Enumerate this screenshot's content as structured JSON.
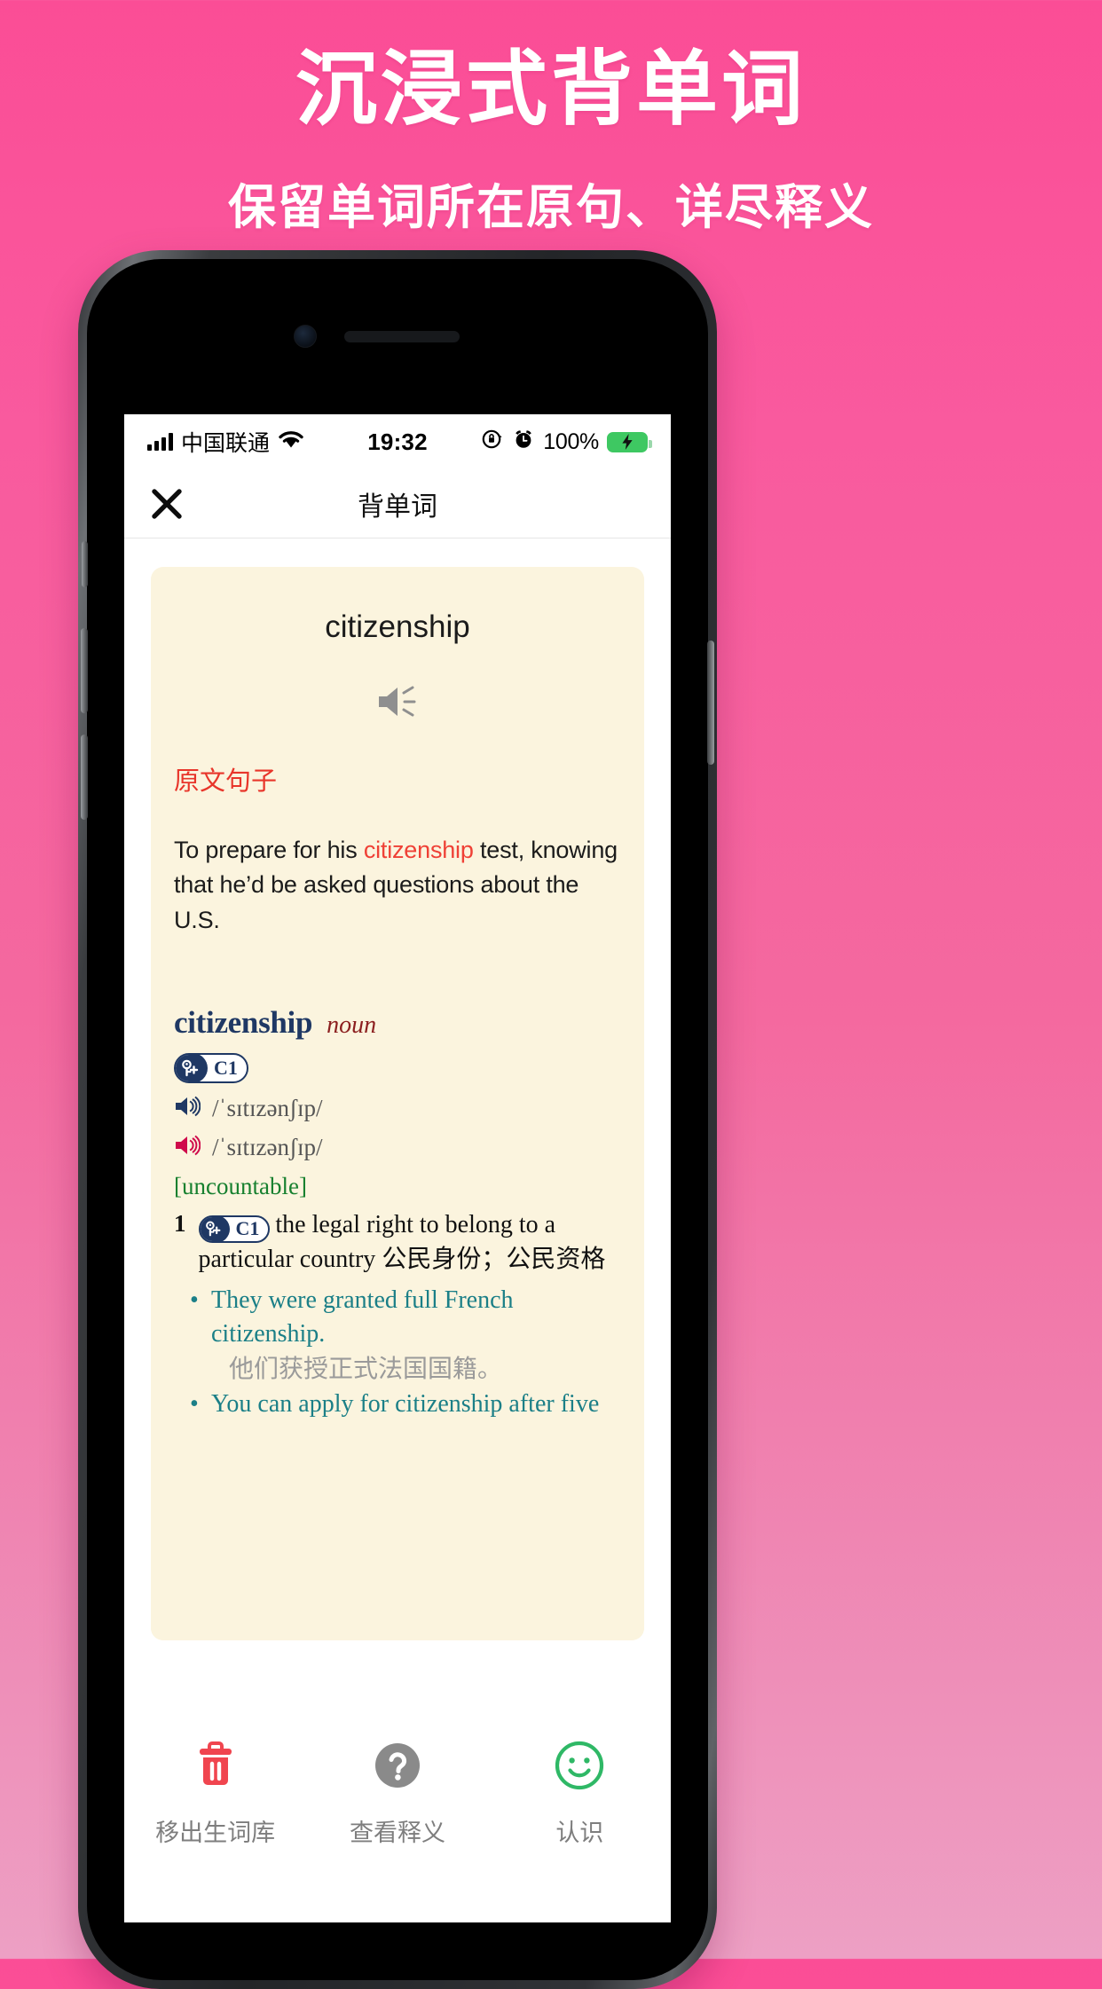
{
  "promo": {
    "title": "沉浸式背单词",
    "subtitle": "保留单词所在原句、详尽释义",
    "bg_start": "#fb4d96",
    "bg_end": "#eda0c4"
  },
  "status_bar": {
    "carrier": "中国联通",
    "signal_icon": "signal-bars-icon",
    "wifi_icon": "wifi-icon",
    "time": "19:32",
    "rotation_lock_icon": "rotation-lock-icon",
    "alarm_icon": "alarm-clock-icon",
    "battery_percent": "100%",
    "battery_icon": "battery-charging-icon",
    "battery_color": "#3ec862"
  },
  "nav": {
    "close_icon": "close-icon",
    "title": "背单词"
  },
  "card": {
    "background": "#fbf4de",
    "word": "citizenship",
    "speaker_icon": "speaker-icon",
    "source_label": "原文句子",
    "source_label_color": "#e8352a",
    "sentence_before": "To prepare for his ",
    "sentence_highlight": "citizenship",
    "sentence_after": " test, knowing that he’d be asked questions about the U.S.",
    "highlight_color": "#ef4136"
  },
  "dictionary": {
    "headword": "citizenship",
    "headword_color": "#1f3864",
    "part_of_speech": "noun",
    "pos_color": "#8c1f1f",
    "cefr_badge": "C1",
    "cefr_icon": "key-plus-icon",
    "pronunciations": [
      {
        "accent_icon": "speaker-icon-british",
        "color": "#1f3864",
        "ipa": "/ˈsɪtɪzənʃɪp/"
      },
      {
        "accent_icon": "speaker-icon-american",
        "color": "#cf0a4b",
        "ipa": "/ˈsɪtɪzənʃɪp/"
      }
    ],
    "grammar_label": "[uncountable]",
    "grammar_color": "#17802f",
    "senses": [
      {
        "number": "1",
        "cefr_badge": "C1",
        "definition_en": "the legal right to belong to a particular country ",
        "definition_cn": "公民身份；公民资格",
        "examples": [
          {
            "en": "They were granted full French citizenship.",
            "cn": "他们获授正式法国国籍。"
          },
          {
            "en": "You can apply for citizenship after five",
            "cn": ""
          }
        ]
      }
    ]
  },
  "toolbar": {
    "items": [
      {
        "icon": "trash-icon",
        "color": "#f0454f",
        "label": "移出生词库"
      },
      {
        "icon": "question-icon",
        "color": "#8a8a8a",
        "label": "查看释义"
      },
      {
        "icon": "smiley-icon",
        "color": "#2fb866",
        "label": "认识"
      }
    ]
  }
}
